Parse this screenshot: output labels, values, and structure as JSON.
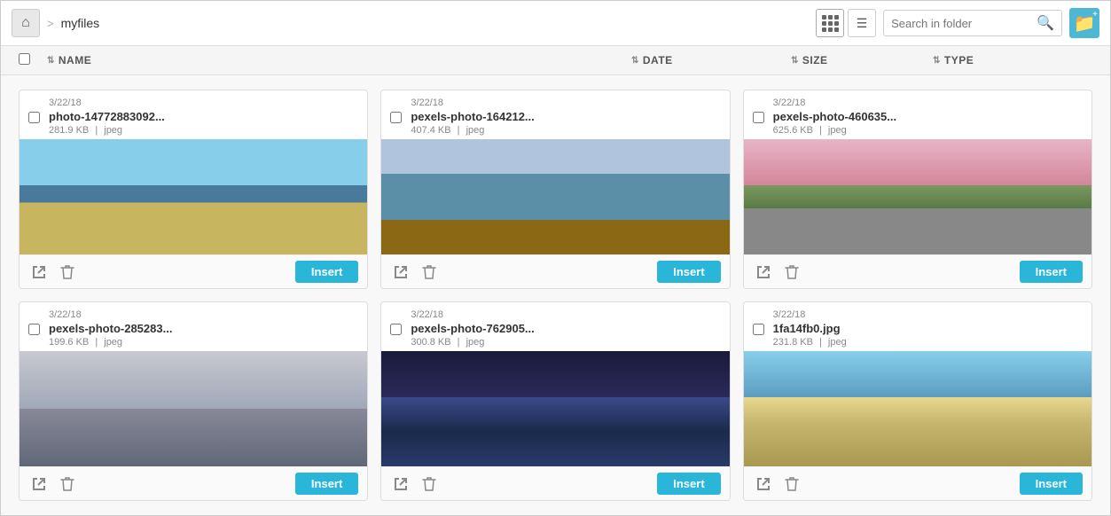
{
  "header": {
    "home_label": "home",
    "breadcrumb_separator": ">",
    "breadcrumb_path": "myfiles",
    "search_placeholder": "Search in folder",
    "new_folder_label": "+"
  },
  "columns": {
    "name_label": "NAME",
    "date_label": "DATE",
    "size_label": "SIZE",
    "type_label": "TYPE"
  },
  "files": [
    {
      "id": 1,
      "date": "3/22/18",
      "name": "photo-14772883092...",
      "size": "281.9 KB",
      "type": "jpeg",
      "thumb_class": "thumb-bridge-day"
    },
    {
      "id": 2,
      "date": "3/22/18",
      "name": "pexels-photo-164212...",
      "size": "407.4 KB",
      "type": "jpeg",
      "thumb_class": "thumb-venice"
    },
    {
      "id": 3,
      "date": "3/22/18",
      "name": "pexels-photo-460635...",
      "size": "625.6 KB",
      "type": "jpeg",
      "thumb_class": "thumb-cherry"
    },
    {
      "id": 4,
      "date": "3/22/18",
      "name": "pexels-photo-285283...",
      "size": "199.6 KB",
      "type": "jpeg",
      "thumb_class": "thumb-bridge-fog"
    },
    {
      "id": 5,
      "date": "3/22/18",
      "name": "pexels-photo-762905...",
      "size": "300.8 KB",
      "type": "jpeg",
      "thumb_class": "thumb-harbor-night"
    },
    {
      "id": 6,
      "date": "3/22/18",
      "name": "1fa14fb0.jpg",
      "size": "231.8 KB",
      "type": "jpeg",
      "thumb_class": "thumb-boardwalk"
    }
  ],
  "buttons": {
    "insert_label": "Insert"
  },
  "colors": {
    "insert_btn": "#29b6d8",
    "header_bg": "#fff",
    "col_header_bg": "#f5f5f5"
  }
}
